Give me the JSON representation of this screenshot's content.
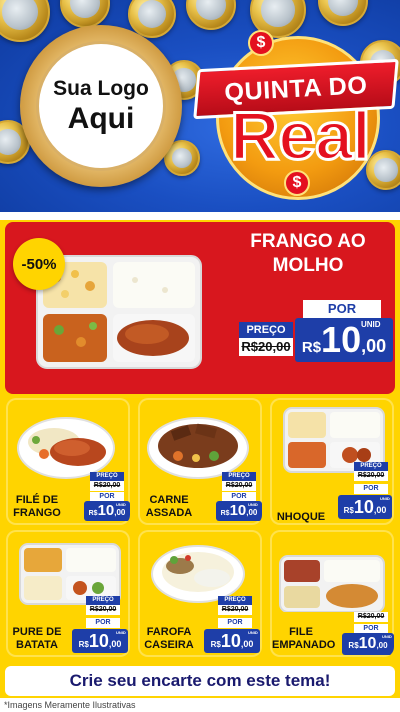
{
  "header": {
    "logo_line1": "Sua Logo",
    "logo_line2": "Aqui",
    "promo_line1": "QUINTA DO",
    "promo_line2": "Real",
    "dollar_symbol": "$"
  },
  "featured": {
    "badge": "-50%",
    "name_line1": "FRANGO AO",
    "name_line2": "MOLHO",
    "preco_label": "PREÇO",
    "old_price": "R$20,00",
    "por_label": "POR",
    "new_currency": "R$",
    "new_int": "10",
    "new_dec": ",00",
    "unid_label": "UNID"
  },
  "items": [
    {
      "name_line1": "FILÉ DE",
      "name_line2": "FRANGO",
      "preco_label": "PREÇO",
      "old_price": "R$20,00",
      "por_label": "POR",
      "currency": "R$",
      "price_int": "10",
      "price_dec": ",00",
      "unid_label": "UNID"
    },
    {
      "name_line1": "CARNE",
      "name_line2": "ASSADA",
      "preco_label": "PREÇO",
      "old_price": "R$20,00",
      "por_label": "POR",
      "currency": "R$",
      "price_int": "10",
      "price_dec": ",00",
      "unid_label": "UNID"
    },
    {
      "name_line1": "NHOQUE",
      "name_line2": "",
      "preco_label": "PREÇO",
      "old_price": "R$20,00",
      "por_label": "POR",
      "currency": "R$",
      "price_int": "10",
      "price_dec": ",00",
      "unid_label": "UNID"
    },
    {
      "name_line1": "PURE DE",
      "name_line2": "BATATA",
      "preco_label": "PREÇO",
      "old_price": "R$20,00",
      "por_label": "POR",
      "currency": "R$",
      "price_int": "10",
      "price_dec": ",00",
      "unid_label": "UNID"
    },
    {
      "name_line1": "FAROFA",
      "name_line2": "CASEIRA",
      "preco_label": "PREÇO",
      "old_price": "R$20,00",
      "por_label": "POR",
      "currency": "R$",
      "price_int": "10",
      "price_dec": ",00",
      "unid_label": "UNID"
    },
    {
      "name_line1": "FILE",
      "name_line2": "EMPANADO",
      "preco_label": "PREÇO",
      "old_price": "R$20,00",
      "por_label": "POR",
      "currency": "R$",
      "price_int": "10",
      "price_dec": ",00",
      "unid_label": "UNID"
    }
  ],
  "footer": {
    "cta": "Crie seu encarte com este tema!",
    "disclaimer": "*Imagens Meramente Ilustrativas"
  },
  "colors": {
    "background_yellow": "#ffd400",
    "featured_red": "#d8171e",
    "price_blue": "#1e3ea8",
    "header_blue": "#1a4fc2"
  }
}
